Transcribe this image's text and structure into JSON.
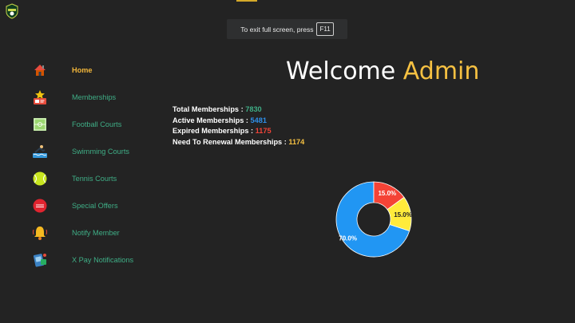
{
  "colors": {
    "background": "#232323",
    "nav_text": "#3fae86",
    "nav_active": "#f2b63a",
    "admin_accent": "#f6c142",
    "total_value": "#3fae86",
    "active_value": "#2f8fe8",
    "expired_value": "#f04438",
    "renewal_value": "#f6c142"
  },
  "fullscreen_toast": {
    "text": "To exit full screen, press",
    "key": "F11"
  },
  "sidebar": {
    "items": [
      {
        "label": "Home",
        "icon": "house-icon",
        "active": true
      },
      {
        "label": "Memberships",
        "icon": "membership-card-icon",
        "active": false
      },
      {
        "label": "Football Courts",
        "icon": "football-field-icon",
        "active": false
      },
      {
        "label": "Swimming Courts",
        "icon": "swimmer-icon",
        "active": false
      },
      {
        "label": "Tennis Courts",
        "icon": "tennis-ball-icon",
        "active": false
      },
      {
        "label": "Special Offers",
        "icon": "offer-tag-icon",
        "active": false
      },
      {
        "label": "Notify Member",
        "icon": "bell-icon",
        "active": false
      },
      {
        "label": "X Pay Notifications",
        "icon": "payment-app-icon",
        "active": false
      }
    ]
  },
  "header": {
    "welcome": "Welcome",
    "admin": "Admin"
  },
  "stats": {
    "total": {
      "label": "Total Memberships :",
      "value": "7830"
    },
    "active": {
      "label": "Active Memberships :",
      "value": "5481"
    },
    "expired": {
      "label": "Expired Memberships :",
      "value": "1175"
    },
    "renewal": {
      "label": "Need To Renewal Memberships :",
      "value": "1174"
    }
  },
  "chart_data": {
    "type": "pie",
    "variant": "doughnut",
    "slices": [
      {
        "label": "70.0%",
        "value": 70.0,
        "color": "#2196f3"
      },
      {
        "label": "15.0%",
        "value": 15.0,
        "color": "#f44336"
      },
      {
        "label": "15.0%",
        "value": 15.0,
        "color": "#ffeb3b"
      }
    ],
    "legend": "none",
    "title": ""
  }
}
